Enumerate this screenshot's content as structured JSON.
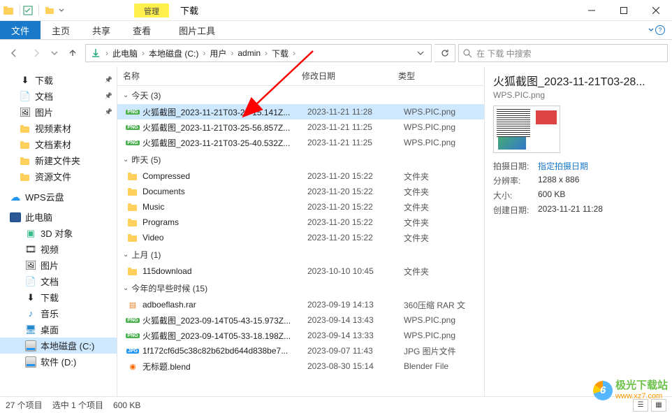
{
  "titlebar": {
    "manage_tab": "管理",
    "title": "下载"
  },
  "ribbon": {
    "file": "文件",
    "home": "主页",
    "share": "共享",
    "view": "查看",
    "pic_tools": "图片工具"
  },
  "breadcrumb": [
    "此电脑",
    "本地磁盘 (C:)",
    "用户",
    "admin",
    "下载"
  ],
  "search": {
    "placeholder": "在 下载 中搜索"
  },
  "nav": {
    "downloads": "下载",
    "documents": "文档",
    "pictures": "图片",
    "video_mat": "视频素材",
    "doc_mat": "文档素材",
    "new_folder": "新建文件夹",
    "res_files": "资源文件",
    "wps_cloud": "WPS云盘",
    "this_pc": "此电脑",
    "obj3d": "3D 对象",
    "videos": "视频",
    "pictures2": "图片",
    "documents2": "文档",
    "downloads2": "下载",
    "music": "音乐",
    "desktop": "桌面",
    "local_c": "本地磁盘 (C:)",
    "soft_d": "软件 (D:)"
  },
  "columns": {
    "name": "名称",
    "date": "修改日期",
    "type": "类型"
  },
  "groups": {
    "today": "今天",
    "today_count": "(3)",
    "yesterday": "昨天",
    "yesterday_count": "(5)",
    "lastmonth": "上月",
    "lastmonth_count": "(1)",
    "earlier": "今年的早些时候",
    "earlier_count": "(15)"
  },
  "files": {
    "today": [
      {
        "icon": "png",
        "name": "火狐截图_2023-11-21T03-28-15.141Z...",
        "date": "2023-11-21 11:28",
        "type": "WPS.PIC.png",
        "sel": true
      },
      {
        "icon": "png",
        "name": "火狐截图_2023-11-21T03-25-56.857Z...",
        "date": "2023-11-21 11:25",
        "type": "WPS.PIC.png"
      },
      {
        "icon": "png",
        "name": "火狐截图_2023-11-21T03-25-40.532Z...",
        "date": "2023-11-21 11:25",
        "type": "WPS.PIC.png"
      }
    ],
    "yesterday": [
      {
        "icon": "folder",
        "name": "Compressed",
        "date": "2023-11-20 15:22",
        "type": "文件夹"
      },
      {
        "icon": "folder",
        "name": "Documents",
        "date": "2023-11-20 15:22",
        "type": "文件夹"
      },
      {
        "icon": "folder",
        "name": "Music",
        "date": "2023-11-20 15:22",
        "type": "文件夹"
      },
      {
        "icon": "folder",
        "name": "Programs",
        "date": "2023-11-20 15:22",
        "type": "文件夹"
      },
      {
        "icon": "folder",
        "name": "Video",
        "date": "2023-11-20 15:22",
        "type": "文件夹"
      }
    ],
    "lastmonth": [
      {
        "icon": "folder",
        "name": "115download",
        "date": "2023-10-10 10:45",
        "type": "文件夹"
      }
    ],
    "earlier": [
      {
        "icon": "rar",
        "name": "adboeflash.rar",
        "date": "2023-09-19 14:13",
        "type": "360压缩 RAR 文"
      },
      {
        "icon": "png",
        "name": "火狐截图_2023-09-14T05-43-15.973Z...",
        "date": "2023-09-14 13:43",
        "type": "WPS.PIC.png"
      },
      {
        "icon": "png",
        "name": "火狐截图_2023-09-14T05-33-18.198Z...",
        "date": "2023-09-14 13:33",
        "type": "WPS.PIC.png"
      },
      {
        "icon": "jpg",
        "name": "1f172cf6d5c38c82b62bd644d838be7...",
        "date": "2023-09-07 11:43",
        "type": "JPG 图片文件"
      },
      {
        "icon": "blend",
        "name": "无标题.blend",
        "date": "2023-08-30 15:14",
        "type": "Blender File"
      }
    ]
  },
  "preview": {
    "title": "火狐截图_2023-11-21T03-28...",
    "sub": "WPS.PIC.png",
    "meta": [
      {
        "k": "拍摄日期:",
        "v": "指定拍摄日期",
        "link": true
      },
      {
        "k": "分辨率:",
        "v": "1288 x 886"
      },
      {
        "k": "大小:",
        "v": "600 KB"
      },
      {
        "k": "创建日期:",
        "v": "2023-11-21 11:28"
      }
    ]
  },
  "status": {
    "count": "27 个项目",
    "selected": "选中 1 个项目",
    "size": "600 KB"
  },
  "watermark": {
    "line1": "极光下载站",
    "line2": "www.xz7.com"
  }
}
